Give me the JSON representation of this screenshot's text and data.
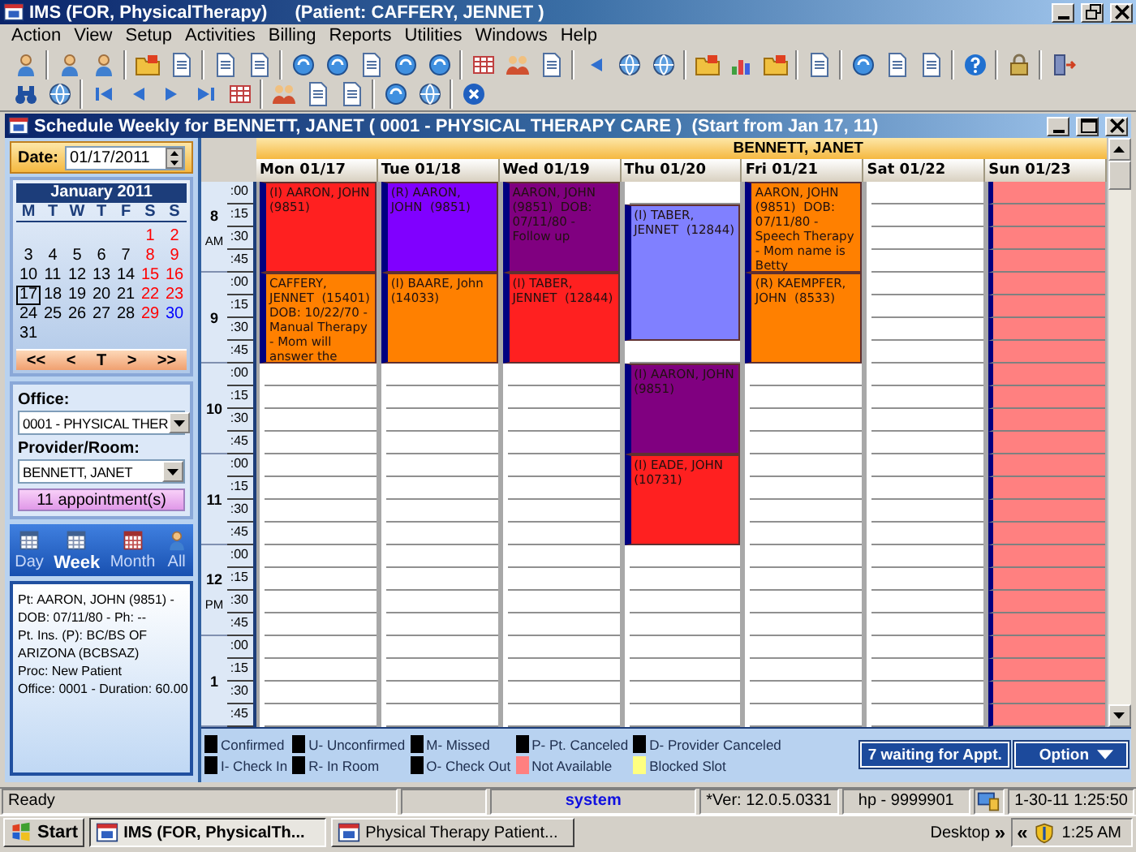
{
  "window": {
    "app": "IMS (FOR, PhysicalTherapy)",
    "patient": "(Patient: CAFFERY, JENNET )"
  },
  "menu": [
    "Action",
    "View",
    "Setup",
    "Activities",
    "Billing",
    "Reports",
    "Utilities",
    "Windows",
    "Help"
  ],
  "schedule": {
    "title": "Schedule Weekly for BENNETT, JANET ( 0001 - PHYSICAL THERAPY CARE )  (Start from Jan 17, 11)",
    "side": {
      "date_label": "Date:",
      "date_value": "01/17/2011",
      "calendar": {
        "month": "January 2011",
        "weekdays": [
          "M",
          "T",
          "W",
          "T",
          "F",
          "S",
          "S"
        ],
        "weeks": [
          [
            {
              "day": "1",
              "color": "#ff0000",
              "selected": false
            },
            {
              "day": "2",
              "color": "#ff0000",
              "selected": false
            }
          ],
          [
            {
              "day": "3",
              "color": "#000000",
              "selected": false
            },
            {
              "day": "4",
              "color": "#000000",
              "selected": false
            },
            {
              "day": "5",
              "color": "#000000",
              "selected": false
            },
            {
              "day": "6",
              "color": "#000000",
              "selected": false
            },
            {
              "day": "7",
              "color": "#000000",
              "selected": false
            },
            {
              "day": "8",
              "color": "#ff0000",
              "selected": false
            },
            {
              "day": "9",
              "color": "#ff0000",
              "selected": false
            }
          ],
          [
            {
              "day": "10",
              "color": "#000000",
              "selected": false
            },
            {
              "day": "11",
              "color": "#000000",
              "selected": false
            },
            {
              "day": "12",
              "color": "#000000",
              "selected": false
            },
            {
              "day": "13",
              "color": "#000000",
              "selected": false
            },
            {
              "day": "14",
              "color": "#000000",
              "selected": false
            },
            {
              "day": "15",
              "color": "#ff0000",
              "selected": false
            },
            {
              "day": "16",
              "color": "#ff0000",
              "selected": false
            }
          ],
          [
            {
              "day": "17",
              "color": "#000000",
              "selected": true
            },
            {
              "day": "18",
              "color": "#000000",
              "selected": false
            },
            {
              "day": "19",
              "color": "#000000",
              "selected": false
            },
            {
              "day": "20",
              "color": "#000000",
              "selected": false
            },
            {
              "day": "21",
              "color": "#000000",
              "selected": false
            },
            {
              "day": "22",
              "color": "#ff0000",
              "selected": false
            },
            {
              "day": "23",
              "color": "#ff0000",
              "selected": false
            }
          ],
          [
            {
              "day": "24",
              "color": "#000000",
              "selected": false
            },
            {
              "day": "25",
              "color": "#000000",
              "selected": false
            },
            {
              "day": "26",
              "color": "#000000",
              "selected": false
            },
            {
              "day": "27",
              "color": "#000000",
              "selected": false
            },
            {
              "day": "28",
              "color": "#000000",
              "selected": false
            },
            {
              "day": "29",
              "color": "#ff0000",
              "selected": false
            },
            {
              "day": "30",
              "color": "#0000ff",
              "selected": false
            }
          ],
          [
            {
              "day": "31",
              "color": "#000000",
              "selected": false
            }
          ]
        ],
        "nav": [
          "<<",
          "<",
          "T",
          ">",
          ">>"
        ]
      },
      "office_label": "Office:",
      "office_value": "0001 - PHYSICAL THER",
      "provider_label": "Provider/Room:",
      "provider_value": "BENNETT, JANET",
      "appointments_button": "11 appointment(s)",
      "views": [
        {
          "label": "Day",
          "selected": false
        },
        {
          "label": "Week",
          "selected": true
        },
        {
          "label": "Month",
          "selected": false
        },
        {
          "label": "All",
          "selected": false
        }
      ],
      "info": [
        "Pt: AARON, JOHN  (9851) -",
        "DOB: 07/11/80 - Ph: --",
        "Pt. Ins. (P): BC/BS OF",
        "ARIZONA (BCBSAZ)",
        "Proc: New Patient",
        "Office: 0001  - Duration: 60.00"
      ]
    },
    "week": {
      "provider": "BENNETT, JANET",
      "hours": [
        {
          "hour": "8",
          "suffix": "AM",
          "minutes": [
            ":00",
            ":15",
            ":30",
            ":45"
          ]
        },
        {
          "hour": "9",
          "minutes": [
            ":00",
            ":15",
            ":30",
            ":45"
          ]
        },
        {
          "hour": "10",
          "minutes": [
            ":00",
            ":15",
            ":30",
            ":45"
          ]
        },
        {
          "hour": "11",
          "minutes": [
            ":00",
            ":15",
            ":30",
            ":45"
          ]
        },
        {
          "hour": "12",
          "suffix": "PM",
          "minutes": [
            ":00",
            ":15",
            ":30",
            ":45"
          ]
        },
        {
          "hour": "1",
          "minutes": [
            ":00",
            ":15",
            ":30",
            ":45"
          ]
        }
      ],
      "days": [
        {
          "label": "Mon 01/17",
          "slots": [
            {
              "kind": "appointment",
              "color": "#ff2020",
              "text": "(I) AARON, JOHN  (9851)"
            },
            {
              "kind": "busy"
            },
            {
              "kind": "busy"
            },
            {
              "kind": "busy"
            },
            {
              "kind": "appointment",
              "color": "#ff8000",
              "text": "CAFFERY, JENNET  (15401)  DOB: 10/22/70 -  Manual Therapy - Mom will answer the"
            },
            {
              "kind": "busy"
            },
            {
              "kind": "busy"
            },
            {
              "kind": "busy"
            },
            {
              "kind": "free"
            },
            {
              "kind": "free"
            },
            {
              "kind": "free"
            },
            {
              "kind": "free"
            },
            {
              "kind": "free"
            },
            {
              "kind": "free"
            },
            {
              "kind": "free"
            },
            {
              "kind": "free"
            },
            {
              "kind": "free"
            },
            {
              "kind": "free"
            },
            {
              "kind": "free"
            },
            {
              "kind": "free"
            },
            {
              "kind": "free"
            },
            {
              "kind": "free"
            },
            {
              "kind": "free"
            },
            {
              "kind": "free"
            }
          ]
        },
        {
          "label": "Tue 01/18",
          "slots": [
            {
              "kind": "appointment",
              "color": "#8000ff",
              "text": "(R) AARON, JOHN  (9851)"
            },
            {
              "kind": "busy"
            },
            {
              "kind": "busy"
            },
            {
              "kind": "busy"
            },
            {
              "kind": "appointment",
              "color": "#ff8000",
              "text": "(I) BAARE, John  (14033)"
            },
            {
              "kind": "busy"
            },
            {
              "kind": "busy"
            },
            {
              "kind": "busy"
            },
            {
              "kind": "free"
            },
            {
              "kind": "free"
            },
            {
              "kind": "free"
            },
            {
              "kind": "free"
            },
            {
              "kind": "free"
            },
            {
              "kind": "free"
            },
            {
              "kind": "free"
            },
            {
              "kind": "free"
            },
            {
              "kind": "free"
            },
            {
              "kind": "free"
            },
            {
              "kind": "free"
            },
            {
              "kind": "free"
            },
            {
              "kind": "free"
            },
            {
              "kind": "free"
            },
            {
              "kind": "free"
            },
            {
              "kind": "free"
            }
          ]
        },
        {
          "label": "Wed 01/19",
          "slots": [
            {
              "kind": "appointment",
              "color": "#800080",
              "text": "AARON, JOHN  (9851)  DOB: 07/11/80 - Follow up"
            },
            {
              "kind": "busy"
            },
            {
              "kind": "busy"
            },
            {
              "kind": "busy"
            },
            {
              "kind": "appointment",
              "color": "#ff2020",
              "text": "(I) TABER, JENNET  (12844)"
            },
            {
              "kind": "busy"
            },
            {
              "kind": "busy"
            },
            {
              "kind": "busy"
            },
            {
              "kind": "free"
            },
            {
              "kind": "free"
            },
            {
              "kind": "free"
            },
            {
              "kind": "free"
            },
            {
              "kind": "free"
            },
            {
              "kind": "free"
            },
            {
              "kind": "free"
            },
            {
              "kind": "free"
            },
            {
              "kind": "free"
            },
            {
              "kind": "free"
            },
            {
              "kind": "free"
            },
            {
              "kind": "free"
            },
            {
              "kind": "free"
            },
            {
              "kind": "free"
            },
            {
              "kind": "free"
            },
            {
              "kind": "free"
            }
          ]
        },
        {
          "label": "Thu 01/20",
          "slots": [
            {
              "kind": "free"
            },
            {
              "kind": "appointment",
              "color": "#8080ff",
              "text": "(I) TABER, JENNET  (12844)"
            },
            {
              "kind": "busy"
            },
            {
              "kind": "busy"
            },
            {
              "kind": "busy"
            },
            {
              "kind": "busy"
            },
            {
              "kind": "busy"
            },
            {
              "kind": "free"
            },
            {
              "kind": "appointment",
              "color": "#800080",
              "text": "(I) AARON, JOHN  (9851)"
            },
            {
              "kind": "busy"
            },
            {
              "kind": "busy"
            },
            {
              "kind": "busy"
            },
            {
              "kind": "appointment",
              "color": "#ff2020",
              "text": "(I) EADE, JOHN  (10731)"
            },
            {
              "kind": "busy"
            },
            {
              "kind": "busy"
            },
            {
              "kind": "busy"
            },
            {
              "kind": "free"
            },
            {
              "kind": "free"
            },
            {
              "kind": "free"
            },
            {
              "kind": "free"
            },
            {
              "kind": "free"
            },
            {
              "kind": "free"
            },
            {
              "kind": "free"
            },
            {
              "kind": "free"
            }
          ]
        },
        {
          "label": "Fri 01/21",
          "slots": [
            {
              "kind": "appointment",
              "color": "#ff8000",
              "text": "AARON, JOHN  (9851)  DOB: 07/11/80 - Speech Therapy - Mom name is Betty"
            },
            {
              "kind": "busy"
            },
            {
              "kind": "busy"
            },
            {
              "kind": "busy"
            },
            {
              "kind": "appointment",
              "color": "#ff8000",
              "text": "(R) KAEMPFER, JOHN  (8533)"
            },
            {
              "kind": "busy"
            },
            {
              "kind": "busy"
            },
            {
              "kind": "busy"
            },
            {
              "kind": "free"
            },
            {
              "kind": "free"
            },
            {
              "kind": "free"
            },
            {
              "kind": "free"
            },
            {
              "kind": "free"
            },
            {
              "kind": "free"
            },
            {
              "kind": "free"
            },
            {
              "kind": "free"
            },
            {
              "kind": "free"
            },
            {
              "kind": "free"
            },
            {
              "kind": "free"
            },
            {
              "kind": "free"
            },
            {
              "kind": "free"
            },
            {
              "kind": "free"
            },
            {
              "kind": "free"
            },
            {
              "kind": "free"
            }
          ]
        },
        {
          "label": "Sat 01/22",
          "slots": [
            {
              "kind": "free"
            },
            {
              "kind": "free"
            },
            {
              "kind": "free"
            },
            {
              "kind": "free"
            },
            {
              "kind": "free"
            },
            {
              "kind": "free"
            },
            {
              "kind": "free"
            },
            {
              "kind": "free"
            },
            {
              "kind": "free"
            },
            {
              "kind": "free"
            },
            {
              "kind": "free"
            },
            {
              "kind": "free"
            },
            {
              "kind": "free"
            },
            {
              "kind": "free"
            },
            {
              "kind": "free"
            },
            {
              "kind": "free"
            },
            {
              "kind": "free"
            },
            {
              "kind": "free"
            },
            {
              "kind": "free"
            },
            {
              "kind": "free"
            },
            {
              "kind": "free"
            },
            {
              "kind": "free"
            },
            {
              "kind": "free"
            },
            {
              "kind": "free"
            }
          ]
        },
        {
          "label": "Sun 01/23",
          "slots": [
            {
              "kind": "unavailable"
            },
            {
              "kind": "unavailable"
            },
            {
              "kind": "unavailable"
            },
            {
              "kind": "unavailable"
            },
            {
              "kind": "unavailable"
            },
            {
              "kind": "unavailable"
            },
            {
              "kind": "unavailable"
            },
            {
              "kind": "unavailable"
            },
            {
              "kind": "unavailable"
            },
            {
              "kind": "unavailable"
            },
            {
              "kind": "unavailable"
            },
            {
              "kind": "unavailable"
            },
            {
              "kind": "unavailable"
            },
            {
              "kind": "unavailable"
            },
            {
              "kind": "unavailable"
            },
            {
              "kind": "unavailable"
            },
            {
              "kind": "unavailable"
            },
            {
              "kind": "unavailable"
            },
            {
              "kind": "unavailable"
            },
            {
              "kind": "unavailable"
            },
            {
              "kind": "unavailable"
            },
            {
              "kind": "unavailable"
            },
            {
              "kind": "unavailable"
            },
            {
              "kind": "unavailable"
            }
          ]
        }
      ]
    },
    "legend": [
      {
        "label": "Confirmed",
        "color": "#000000"
      },
      {
        "label": "I- Check In",
        "color": "#000000"
      },
      {
        "label": "U- Unconfirmed",
        "color": "#000000"
      },
      {
        "label": "R- In Room",
        "color": "#000000"
      },
      {
        "label": "M- Missed",
        "color": "#000000"
      },
      {
        "label": "O- Check Out",
        "color": "#000000"
      },
      {
        "label": "P- Pt. Canceled",
        "color": "#000000"
      },
      {
        "label": "Not Available",
        "color": "#ff8080"
      },
      {
        "label": "D- Provider Canceled",
        "color": "#000000"
      },
      {
        "label": "Blocked Slot",
        "color": "#ffff80"
      }
    ],
    "waiting_button": "7 waiting for Appt.",
    "option_button": "Option"
  },
  "status_bar": {
    "message": "Ready",
    "user": "system",
    "version": "*Ver: 12.0.5.0331",
    "station": "hp - 9999901",
    "datetime": "1-30-11 1:25:50"
  },
  "taskbar": {
    "start": "Start",
    "tasks": [
      {
        "label": "IMS (FOR, PhysicalTh...",
        "selected": true
      },
      {
        "label": "Physical Therapy Patient...",
        "selected": false
      }
    ],
    "desktop": "Desktop",
    "expand": "»",
    "collapse": "«",
    "clock": "1:25 AM"
  }
}
